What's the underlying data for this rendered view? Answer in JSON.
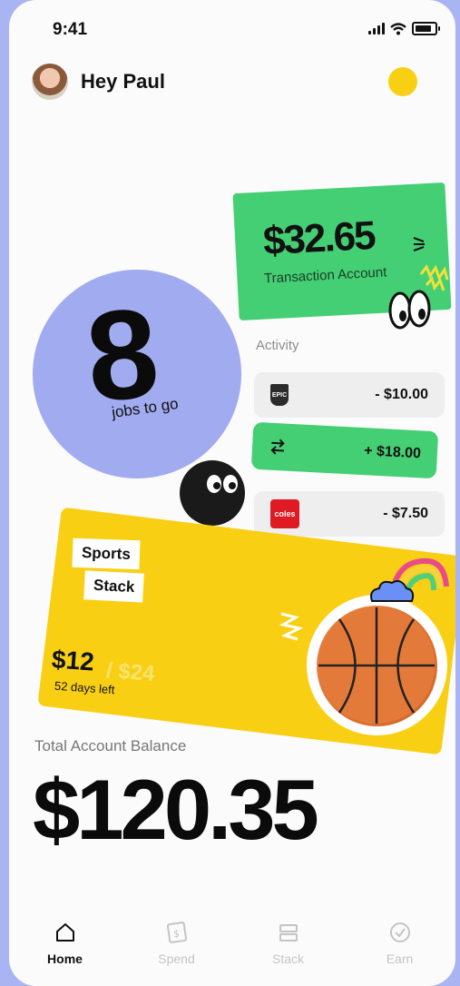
{
  "status_bar": {
    "time": "9:41"
  },
  "header": {
    "greeting": "Hey Paul"
  },
  "transaction_account": {
    "amount": "$32.65",
    "label": "Transaction Account"
  },
  "jobs": {
    "count": "8",
    "label": "jobs to go"
  },
  "activity": {
    "title": "Activity",
    "items": [
      {
        "merchant_badge": "EPIC",
        "amount": "- $10.00"
      },
      {
        "amount": "+ $18.00"
      },
      {
        "merchant_badge": "coles",
        "amount": "- $7.50"
      }
    ]
  },
  "stack_card": {
    "tag_1": "Sports",
    "tag_2": "Stack",
    "saved": "$12",
    "goal": "/ $24",
    "days_left": "52 days left"
  },
  "balance": {
    "label": "Total Account Balance",
    "amount": "$120.35"
  },
  "nav": [
    {
      "label": "Home",
      "icon": "home-icon",
      "active": true
    },
    {
      "label": "Spend",
      "icon": "dollar-note-icon",
      "active": false
    },
    {
      "label": "Stack",
      "icon": "stack-icon",
      "active": false
    },
    {
      "label": "Earn",
      "icon": "check-circle-icon",
      "active": false
    }
  ],
  "colors": {
    "background": "#a9b4f2",
    "green": "#44cf74",
    "blue_circle": "#a1abf0",
    "yellow": "#f9cf14",
    "coles_red": "#e01a22"
  }
}
